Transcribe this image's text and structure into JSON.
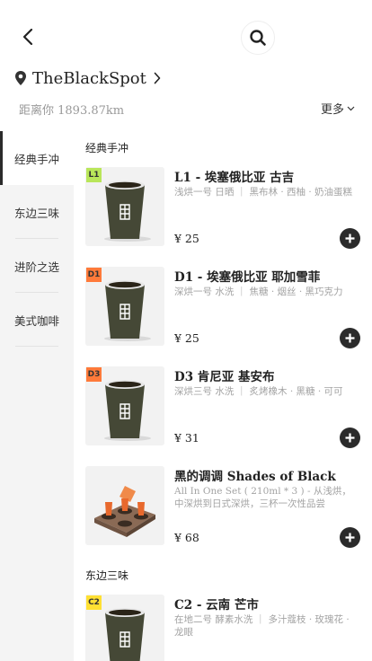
{
  "header": {
    "store_name": "TheBlackSpot",
    "distance": "距离你 1893.87km",
    "more_label": "更多"
  },
  "sidebar": {
    "items": [
      {
        "label": "经典手冲",
        "active": true
      },
      {
        "label": "东边三味",
        "active": false
      },
      {
        "label": "进阶之选",
        "active": false
      },
      {
        "label": "美式咖啡",
        "active": false
      }
    ]
  },
  "sections": [
    {
      "title": "经典手冲",
      "products": [
        {
          "badge": "L1",
          "badge_color": "#b9e65a",
          "name": "L1 - 埃塞俄比亚 古吉",
          "desc": "浅烘一号 日晒 ｜ 黑布林 · 西柚 · 奶油蛋糕",
          "price": "¥ 25",
          "image": "coffee-cup"
        },
        {
          "badge": "D1",
          "badge_color": "#ff7a3a",
          "name": "D1 - 埃塞俄比亚 耶加雪菲",
          "desc": "深烘一号 水洗 ｜ 焦糖 · 烟丝 · 黑巧克力",
          "price": "¥ 25",
          "image": "coffee-cup"
        },
        {
          "badge": "D3",
          "badge_color": "#ff7a3a",
          "name": "D3 肯尼亚 基安布",
          "desc": "深烘三号 水洗 ｜ 炙烤橡木 · 黑糖 · 可可",
          "price": "¥ 31",
          "image": "coffee-cup"
        },
        {
          "badge": "",
          "badge_color": "",
          "name": "黑的调调 Shades of Black",
          "desc": "All In One Set ( 210ml * 3 ) - 从浅烘，中深烘到日式深烘，三杯一次性品尝",
          "price": "¥ 68",
          "image": "cup-tray"
        }
      ]
    },
    {
      "title": "东边三味",
      "products": [
        {
          "badge": "C2",
          "badge_color": "#ffe033",
          "name": "C2 - 云南 芒市",
          "desc": "在地二号 酵素水洗 ｜ 多汁蔻枝 · 玫瑰花 · 龙眼",
          "price": "",
          "image": "coffee-cup"
        }
      ]
    }
  ],
  "colors": {
    "dark_accent": "#2b2b2b",
    "sidebar_bg": "#f4f4f4",
    "muted_text": "#a3a3a3",
    "cup_body": "#454836"
  }
}
